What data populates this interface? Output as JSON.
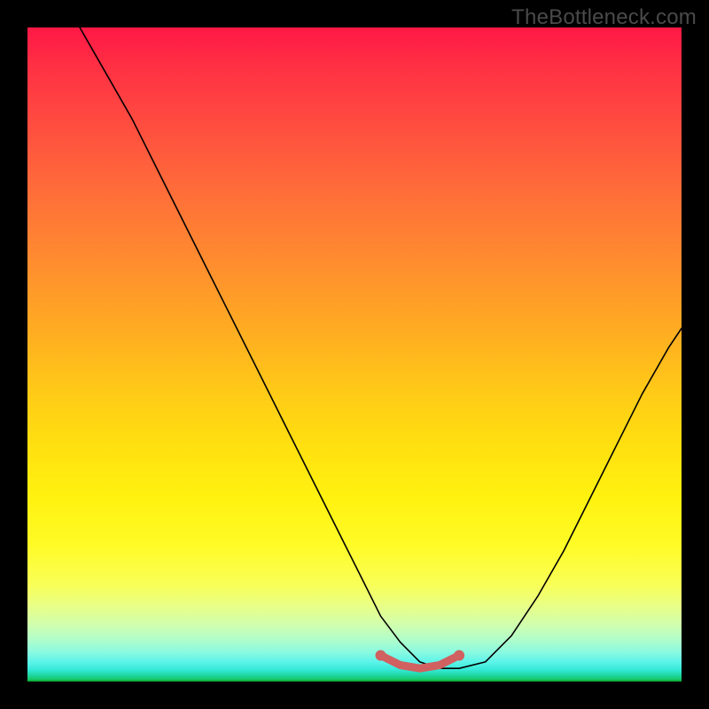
{
  "watermark": "TheBottleneck.com",
  "chart_data": {
    "type": "line",
    "title": "",
    "xlabel": "",
    "ylabel": "",
    "xlim": [
      0,
      100
    ],
    "ylim": [
      0,
      100
    ],
    "grid": false,
    "legend": false,
    "annotations": [],
    "series": [
      {
        "name": "bottleneck-curve",
        "color": "#000000",
        "x": [
          8,
          12,
          16,
          20,
          24,
          28,
          32,
          36,
          40,
          44,
          48,
          51,
          54,
          57,
          60,
          63,
          66,
          70,
          74,
          78,
          82,
          86,
          90,
          94,
          98,
          100
        ],
        "y": [
          100,
          93,
          86,
          78,
          70,
          62,
          54,
          46,
          38,
          30,
          22,
          16,
          10,
          6,
          3,
          2,
          2,
          3,
          7,
          13,
          20,
          28,
          36,
          44,
          51,
          54
        ]
      },
      {
        "name": "optimal-range",
        "color": "#d16060",
        "x": [
          54,
          57,
          60,
          63,
          66
        ],
        "y": [
          4,
          2.5,
          2,
          2.5,
          4
        ]
      }
    ],
    "markers": [
      {
        "name": "optimal-start",
        "x": 54,
        "y": 4,
        "color": "#d16060"
      },
      {
        "name": "optimal-end",
        "x": 66,
        "y": 4,
        "color": "#d16060"
      }
    ],
    "gradient_stops": [
      {
        "pct": 0,
        "color": "#ff1846"
      },
      {
        "pct": 50,
        "color": "#ffc818"
      },
      {
        "pct": 80,
        "color": "#fffb26"
      },
      {
        "pct": 100,
        "color": "#15c252"
      }
    ]
  }
}
